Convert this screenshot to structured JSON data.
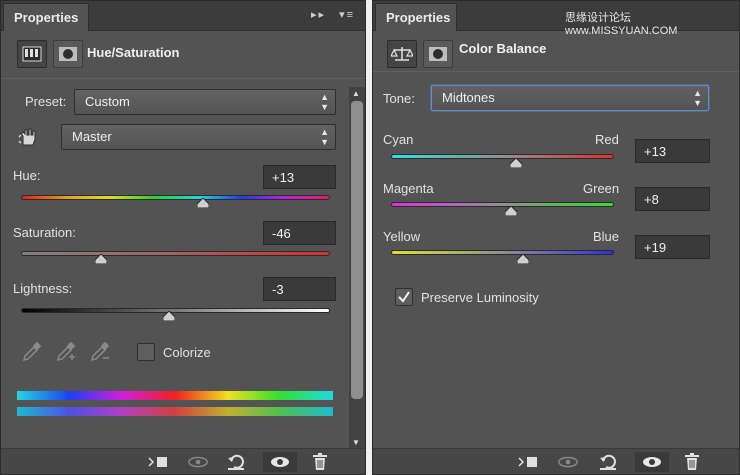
{
  "watermark": "思缘设计论坛 www.MISSYUAN.COM",
  "left": {
    "tab_label": "Properties",
    "menu_symbols": "▸▸ ▾≡",
    "adjustment_icon": "hue-saturation-icon",
    "mask_icon": "mask-icon",
    "title": "Hue/Saturation",
    "preset_label": "Preset:",
    "preset_value": "Custom",
    "channel_value": "Master",
    "sliders": [
      {
        "label": "Hue:",
        "value": "+13",
        "position": 0.59
      },
      {
        "label": "Saturation:",
        "value": "-46",
        "position": 0.26
      },
      {
        "label": "Lightness:",
        "value": "-3",
        "position": 0.48
      }
    ],
    "colorize_label": "Colorize",
    "colorize_checked": false
  },
  "right": {
    "tab_label": "Properties",
    "menu_symbols": "▾≡",
    "adjustment_icon": "color-balance-icon",
    "mask_icon": "mask-icon",
    "title": "Color Balance",
    "tone_label": "Tone:",
    "tone_value": "Midtones",
    "sliders": [
      {
        "left": "Cyan",
        "right": "Red",
        "value": "+13",
        "position": 0.56
      },
      {
        "left": "Magenta",
        "right": "Green",
        "value": "+8",
        "position": 0.54
      },
      {
        "left": "Yellow",
        "right": "Blue",
        "value": "+19",
        "position": 0.59
      }
    ],
    "preserve_label": "Preserve Luminosity",
    "preserve_checked": true
  },
  "colors": {
    "panel_bg": "#535353",
    "titlebar_bg": "#3c3c3c",
    "focus_border": "#6c8cbc"
  }
}
